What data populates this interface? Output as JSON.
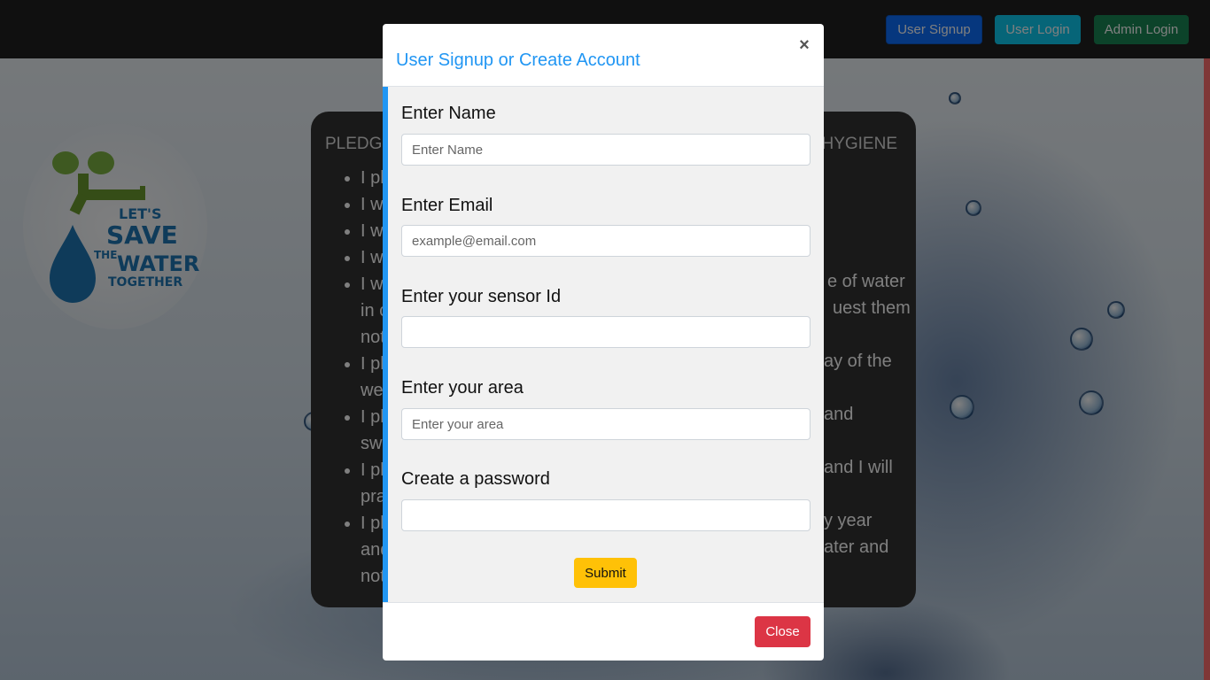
{
  "navbar": {
    "signup_label": "User Signup",
    "login_label": "User Login",
    "admin_label": "Admin Login"
  },
  "logo": {
    "line1": "LET'S",
    "line2": "SAVE",
    "line3": "THE",
    "line4": "WATER",
    "line5": "TOGETHER"
  },
  "pledge": {
    "title": "PLEDGE",
    "title_right": "HYGIENE",
    "items": [
      "I pl",
      "I w",
      "I w",
      "I w",
      "I w",
      "I pl",
      "I pl",
      "I pl",
      "I pl"
    ],
    "continuations": [
      "in c",
      "not",
      "we",
      "sw",
      "pra",
      "and",
      "not"
    ],
    "right_fragments": [
      "e of water",
      "uest them",
      "ay of the",
      "and",
      "and I will",
      "y year",
      "ater and"
    ]
  },
  "modal": {
    "title": "User Signup or Create Account",
    "close_symbol": "×",
    "fields": [
      {
        "label": "Enter Name",
        "placeholder": "Enter Name"
      },
      {
        "label": "Enter Email",
        "placeholder": "example@email.com"
      },
      {
        "label": "Enter your sensor Id",
        "placeholder": ""
      },
      {
        "label": "Enter your area",
        "placeholder": "Enter your area"
      },
      {
        "label": "Create a password",
        "placeholder": ""
      }
    ],
    "submit_label": "Submit",
    "close_label": "Close"
  },
  "colors": {
    "accent": "#2196f3",
    "submit": "#ffc107",
    "close": "#dc3545",
    "navbar": "#212121"
  }
}
